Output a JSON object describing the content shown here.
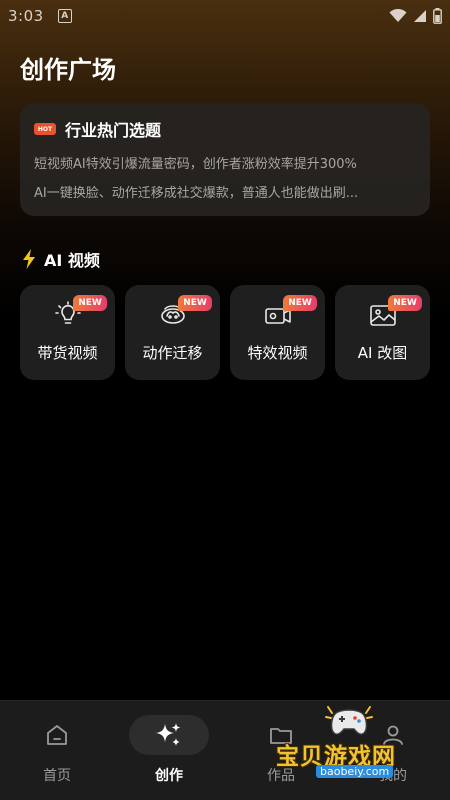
{
  "status_bar": {
    "time": "3:03",
    "notif_glyph": "A"
  },
  "page": {
    "title": "创作广场"
  },
  "topic_card": {
    "badge": "HOT",
    "title": "行业热门选题",
    "lines": [
      "短视频AI特效引爆流量密码，创作者涨粉效率提升300%",
      "AI一键换脸、动作迁移成社交爆款，普通人也能做出刷..."
    ]
  },
  "section": {
    "icon": "lightning-icon",
    "title": "AI 视频"
  },
  "tools": [
    {
      "label": "带货视频",
      "icon": "lightbulb-icon",
      "badge": "NEW"
    },
    {
      "label": "动作迁移",
      "icon": "motion-transfer-icon",
      "badge": "NEW"
    },
    {
      "label": "特效视频",
      "icon": "video-effect-icon",
      "badge": "NEW"
    },
    {
      "label": "AI 改图",
      "icon": "image-edit-icon",
      "badge": "NEW"
    }
  ],
  "bottom_nav": [
    {
      "label": "首页",
      "icon": "home-icon",
      "active": false
    },
    {
      "label": "创作",
      "icon": "sparkle-icon",
      "active": true
    },
    {
      "label": "作品",
      "icon": "folder-icon",
      "active": false
    },
    {
      "label": "我的",
      "icon": "profile-icon",
      "active": false
    }
  ],
  "watermark": {
    "text": "宝贝游戏网",
    "url": "baobeiy.com"
  },
  "colors": {
    "accent_new_start": "#f07a3a",
    "accent_new_end": "#e63d6a",
    "hot_badge": "#e8532d",
    "bolt": "#f5c518"
  }
}
